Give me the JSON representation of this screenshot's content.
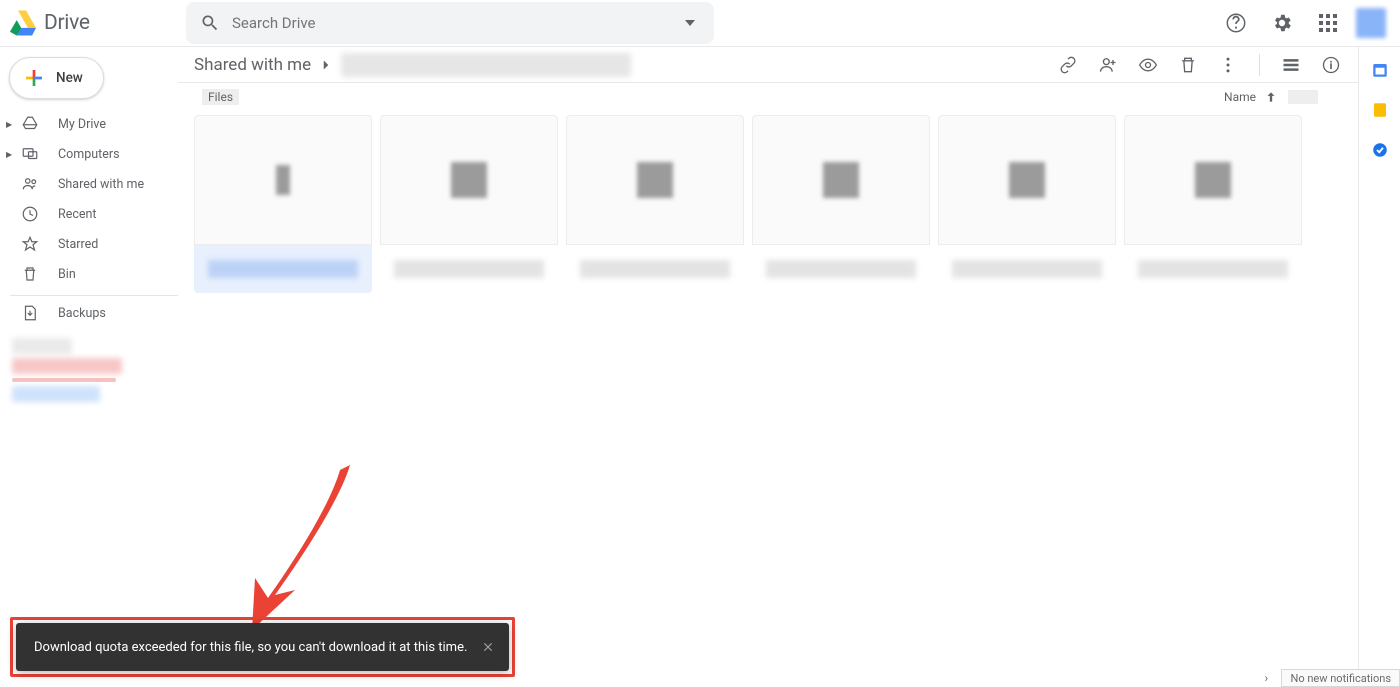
{
  "brand": {
    "name": "Drive"
  },
  "search": {
    "placeholder": "Search Drive"
  },
  "new_button": {
    "label": "New"
  },
  "sidebar": {
    "items": [
      {
        "label": "My Drive"
      },
      {
        "label": "Computers"
      },
      {
        "label": "Shared with me"
      },
      {
        "label": "Recent"
      },
      {
        "label": "Starred"
      },
      {
        "label": "Bin"
      }
    ],
    "backups_label": "Backups"
  },
  "breadcrumb": {
    "root": "Shared with me"
  },
  "list": {
    "section_label": "Files",
    "sort_label": "Name"
  },
  "toast": {
    "message": "Download quota exceeded for this file, so you can't download it at this time."
  },
  "status": {
    "notifications": "No new notifications"
  }
}
